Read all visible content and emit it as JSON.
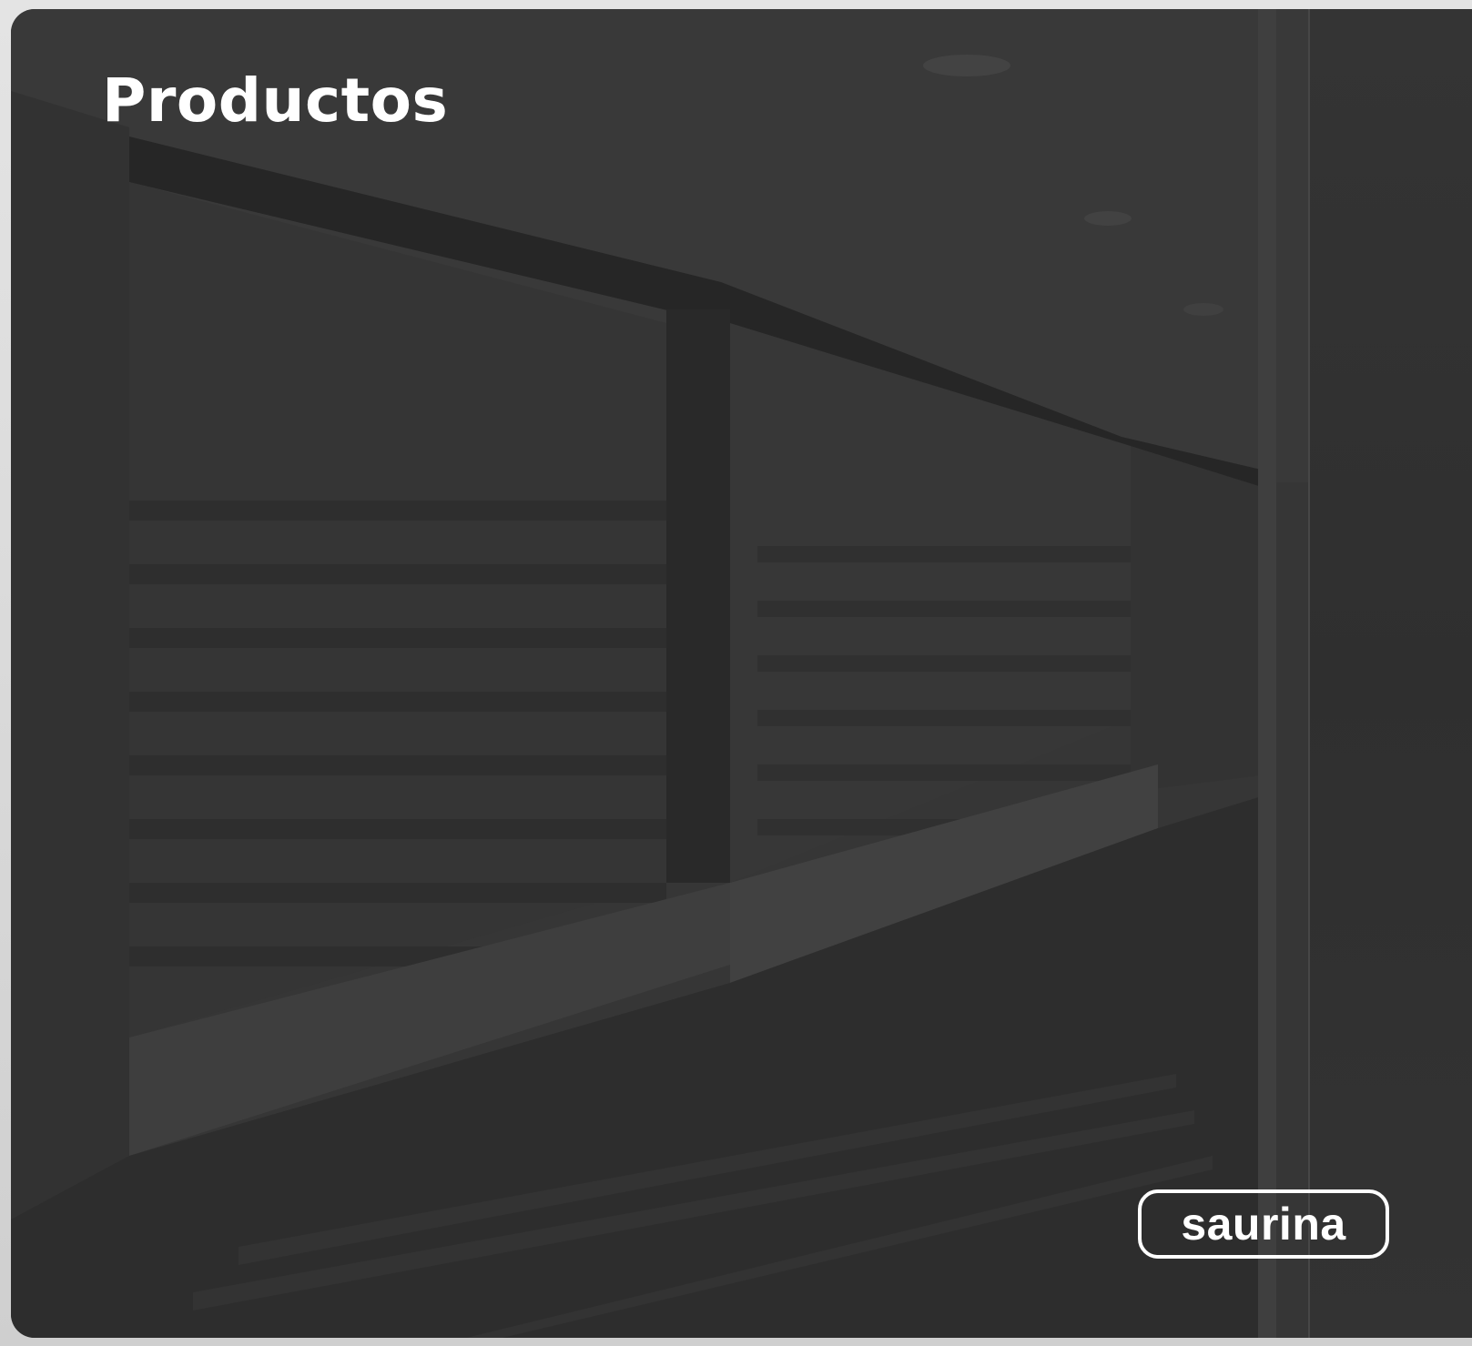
{
  "card": {
    "title": "Productos",
    "background_description": "pharmacy-interior-photo"
  },
  "brand_badge": {
    "label": "saurina"
  },
  "colors": {
    "overlay": "#3a3a3a",
    "text": "#ffffff",
    "page_background": "#d9d9d9"
  }
}
